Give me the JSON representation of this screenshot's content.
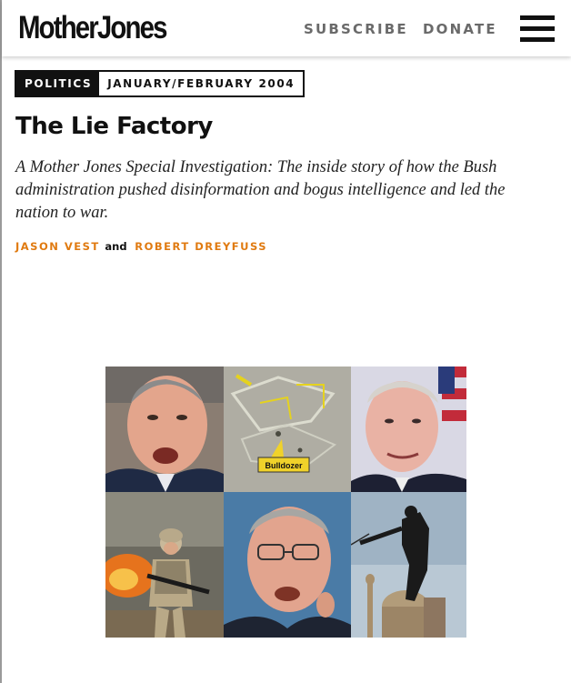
{
  "header": {
    "logo": "MotherJones",
    "nav": {
      "subscribe": "SUBSCRIBE",
      "donate": "DONATE"
    },
    "menu_icon": "hamburger-menu-icon"
  },
  "article": {
    "section": "POLITICS",
    "issue": "JANUARY/FEBRUARY 2004",
    "title": "The Lie Factory",
    "dek": "A Mother Jones Special Investigation: The inside story of how the Bush administration pushed disinformation and bogus intelligence and led the nation to war.",
    "byline": {
      "author1": "JASON VEST",
      "conjunction": "and",
      "author2": "ROBERT DREYFUSS"
    }
  },
  "collage": {
    "map_callout": "Bulldozer"
  },
  "colors": {
    "author": "#e07a10",
    "nav": "#6a6a6a",
    "tag_bg": "#111111"
  }
}
